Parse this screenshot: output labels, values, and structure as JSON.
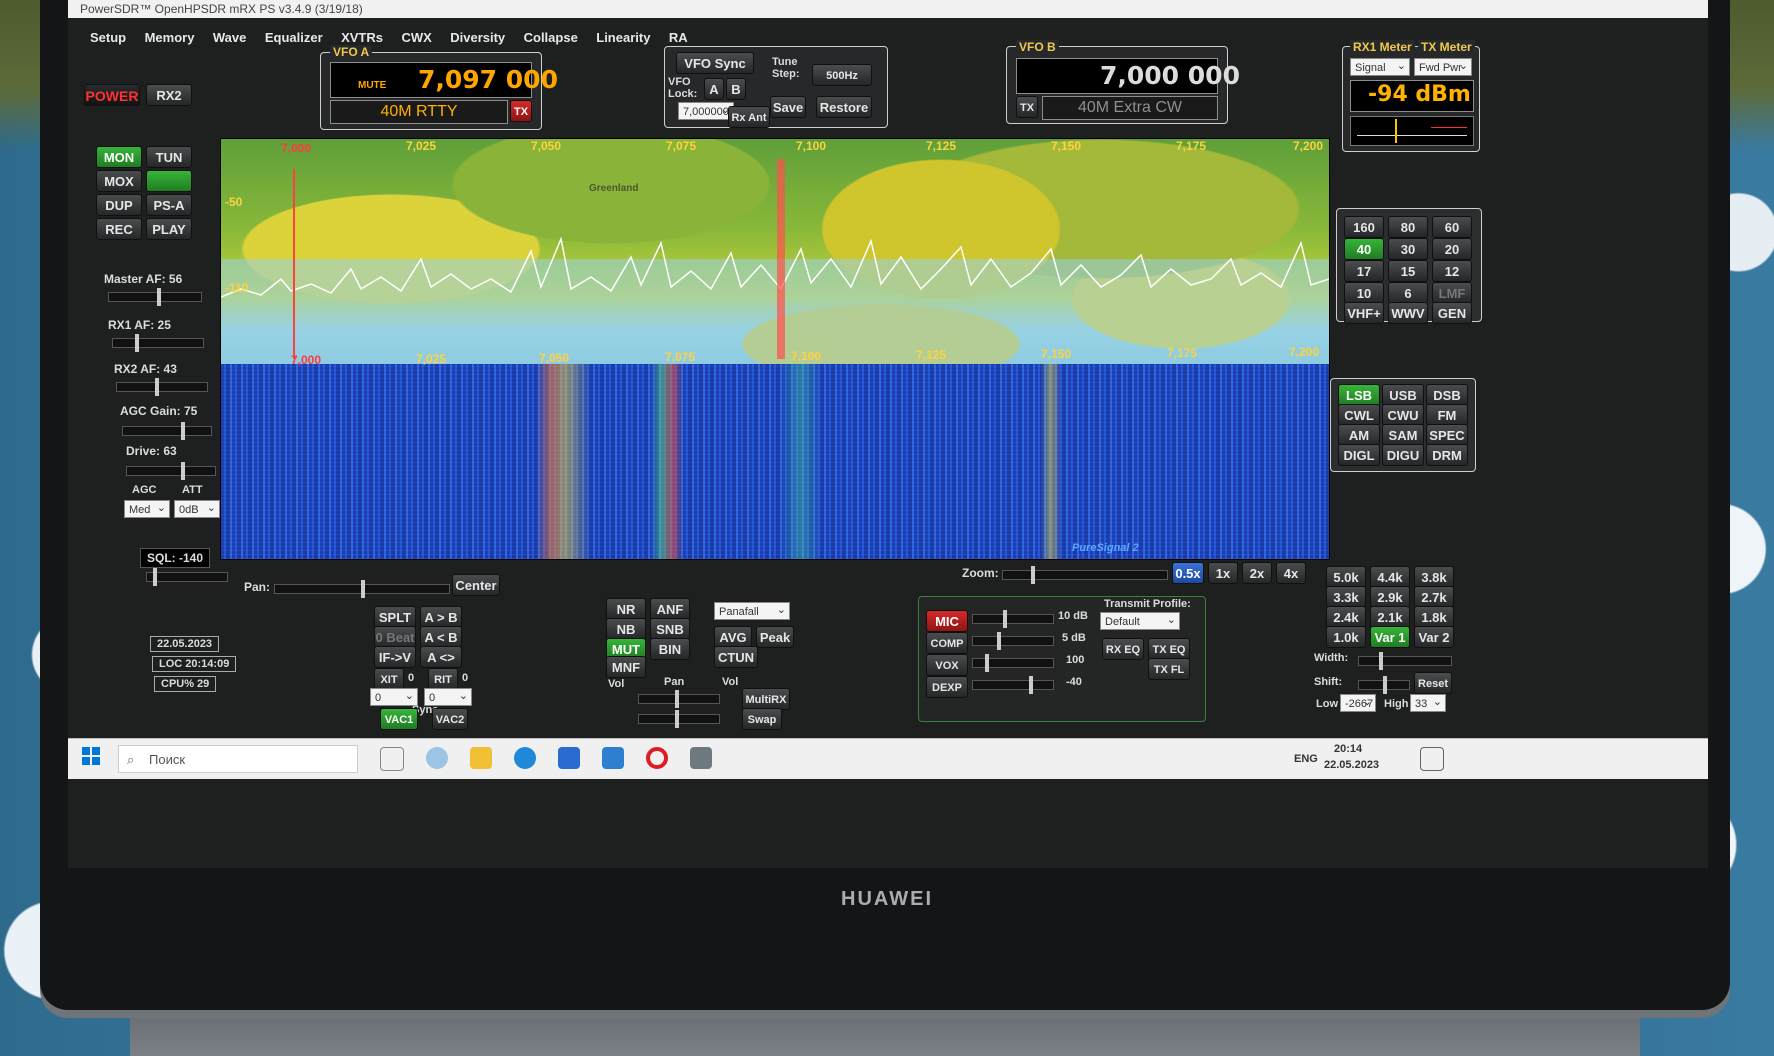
{
  "window": {
    "title": "PowerSDR™ OpenHPSDR mRX PS v3.4.9 (3/19/18)"
  },
  "menu": [
    "Setup",
    "Memory",
    "Wave",
    "Equalizer",
    "XVTRs",
    "CWX",
    "Diversity",
    "Collapse",
    "Linearity",
    "RA"
  ],
  "left": {
    "power": "POWER",
    "rx2": "RX2",
    "mon": "MON",
    "tun": "TUN",
    "mox": "MOX",
    "dup": "DUP",
    "psa": "PS-A",
    "rec": "REC",
    "play": "PLAY",
    "master_af": "Master AF: 56",
    "rx1_af": "RX1 AF: 25",
    "rx2_af": "RX2 AF: 43",
    "agc_gain": "AGC Gain: 75",
    "drive": "Drive: 63",
    "agc": "AGC",
    "att": "ATT",
    "agc_value": "Med",
    "att_value": "0dB",
    "sql": "SQL: -140",
    "date": "22.05.2023",
    "loc": "LOC 20:14:09",
    "cpu": "CPU% 29"
  },
  "vfo_a": {
    "title": "VFO A",
    "mute": "MUTE",
    "freq": "7,097 000",
    "mode": "40M RTTY",
    "tx": "TX"
  },
  "vfo_sync": {
    "sync": "VFO Sync",
    "tune": "Tune",
    "step": "Step:",
    "step_value": "500Hz",
    "vfo": "VFO",
    "lock": "Lock:",
    "a": "A",
    "b": "B",
    "mem_freq": "7,000000",
    "rx_ant": "Rx Ant",
    "save": "Save",
    "restore": "Restore"
  },
  "vfo_b": {
    "title": "VFO B",
    "freq": "7,000 000",
    "mode": "40M Extra CW",
    "tx": "TX"
  },
  "meters": {
    "rx1": "RX1 Meter",
    "tx": "TX Meter",
    "rx1_select": "Signal",
    "tx_select": "Fwd Pwr",
    "reading": "-94 dBm"
  },
  "display": {
    "top_freqs": [
      "7,000",
      "7,025",
      "7,050",
      "7,075",
      "7,100",
      "7,125",
      "7,150",
      "7,175",
      "7,200"
    ],
    "bottom_freqs": [
      "7,000",
      "7,025",
      "7,050",
      "7,075",
      "7,100",
      "7,125",
      "7,150",
      "7,175",
      "7,200"
    ],
    "db_top": "-50",
    "db_bottom": "-110",
    "greenland": "Greenland",
    "puresignal": "PureSignal 2"
  },
  "bands": [
    "160",
    "80",
    "60",
    "40",
    "30",
    "20",
    "17",
    "15",
    "12",
    "10",
    "6",
    "LMF",
    "VHF+",
    "WWV",
    "GEN"
  ],
  "modes": [
    "LSB",
    "USB",
    "DSB",
    "CWL",
    "CWU",
    "FM",
    "AM",
    "SAM",
    "SPEC",
    "DIGL",
    "DIGU",
    "DRM"
  ],
  "filters": [
    "5.0k",
    "4.4k",
    "3.8k",
    "3.3k",
    "2.9k",
    "2.7k",
    "2.4k",
    "2.1k",
    "1.8k",
    "1.0k",
    "Var 1",
    "Var 2"
  ],
  "filter_ctrl": {
    "width": "Width:",
    "shift": "Shift:",
    "reset": "Reset",
    "low": "Low",
    "low_value": "-2667",
    "high": "High",
    "high_value": "33"
  },
  "zoom": {
    "label": "Zoom:",
    "opts": [
      "0.5x",
      "1x",
      "2x",
      "4x"
    ]
  },
  "pan": {
    "label": "Pan:",
    "center": "Center"
  },
  "vfo_ops": {
    "splt": "SPLT",
    "atob": "A > B",
    "obeat": "0 Beat",
    "btoa": "A < B",
    "ifv": "IF->V",
    "swap": "A <> B",
    "xit": "XIT",
    "xit_val": "0",
    "rit": "RIT",
    "rit_val": "0",
    "sync": "Sync",
    "vac1": "VAC1",
    "vac2": "VAC2",
    "xit_num": "0",
    "rit_num": "0"
  },
  "dsp": {
    "nr": "NR",
    "anf": "ANF",
    "nb": "NB",
    "snb": "SNB",
    "mut": "MUT",
    "bin": "BIN",
    "mnf": "MNF",
    "display_mode": "Panafall",
    "avg": "AVG",
    "peak": "Peak",
    "ctun": "CTUN"
  },
  "mix": {
    "vol": "Vol",
    "pan": "Pan",
    "vol2": "Vol",
    "multirx": "MultiRX",
    "swap": "Swap"
  },
  "tx": {
    "mic": "MIC",
    "mic_val": "10 dB",
    "comp": "COMP",
    "comp_val": "5 dB",
    "vox": "VOX",
    "vox_val": "100",
    "dexp": "DEXP",
    "dexp_val": "-40",
    "profile_label": "Transmit Profile:",
    "profile": "Default",
    "rxeq": "RX EQ",
    "txeq": "TX EQ",
    "txfl": "TX FL"
  },
  "taskbar": {
    "search": "Поиск",
    "lang": "ENG",
    "time": "20:14",
    "date": "22.05.2023"
  },
  "brand": "HUAWEI"
}
